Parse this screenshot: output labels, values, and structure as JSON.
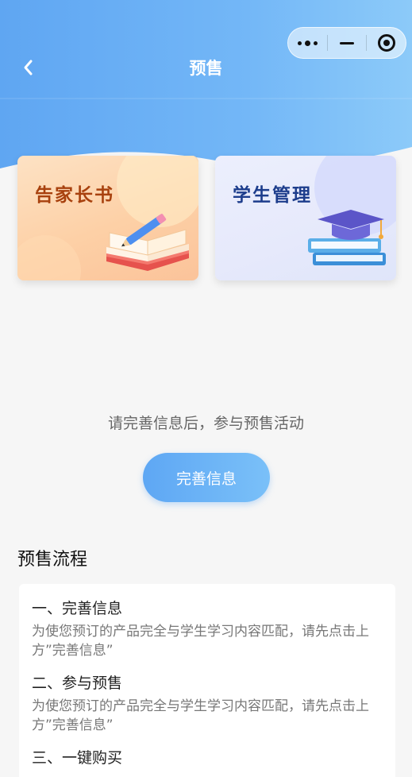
{
  "nav": {
    "title": "预售"
  },
  "cards": [
    {
      "title": "告家长书"
    },
    {
      "title": "学生管理"
    }
  ],
  "prompt": "请完善信息后，参与预售活动",
  "complete_button_label": "完善信息",
  "process": {
    "title": "预售流程",
    "steps": [
      {
        "title": "一、完善信息",
        "desc": "为使您预订的产品完全与学生学习内容匹配，请先点击上方”完善信息”"
      },
      {
        "title": "二、参与预售",
        "desc": "为使您预订的产品完全与学生学习内容匹配，请先点击上方”完善信息”"
      },
      {
        "title": "三、一键购买",
        "desc": ""
      }
    ]
  },
  "colors": {
    "header_start": "#5fa6f2",
    "header_end": "#8ccaf9",
    "button_start": "#5ea7f4",
    "button_end": "#7ac0f8"
  },
  "icons": {
    "back": "back-arrow-icon",
    "more": "more-dots-icon",
    "minimize": "minimize-icon",
    "close": "target-close-icon"
  }
}
